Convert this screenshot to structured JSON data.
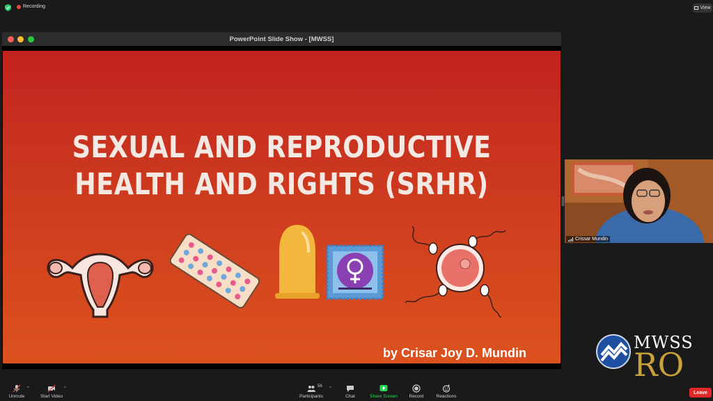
{
  "topbar": {
    "recording_label": "Recording",
    "view_label": "View"
  },
  "window": {
    "title": "PowerPoint Slide Show - [MWSS]"
  },
  "slide": {
    "title_line1": "SEXUAL AND REPRODUCTIVE",
    "title_line2": "HEALTH AND RIGHTS (SRHR)",
    "byline": "by Crisar Joy D. Mundin",
    "icons": [
      "uterus-icon",
      "contraceptive-pills-icon",
      "condom-icon",
      "female-symbol-packet-icon",
      "egg-and-sperm-icon"
    ]
  },
  "participant": {
    "name": "Crissar Mundin"
  },
  "logo": {
    "line1": "MWSS",
    "line2": "RO"
  },
  "toolbar": {
    "unmute": "Unmute",
    "start_video": "Start Video",
    "participants": "Participants",
    "participants_count": "56",
    "chat": "Chat",
    "share_screen": "Share Screen",
    "record": "Record",
    "reactions": "Reactions",
    "leave": "Leave"
  },
  "colors": {
    "slide_top": "#c1231f",
    "slide_bottom": "#dc521e",
    "share_green": "#23d959",
    "leave_red": "#e02828",
    "logo_gold": "#c9a13b"
  }
}
